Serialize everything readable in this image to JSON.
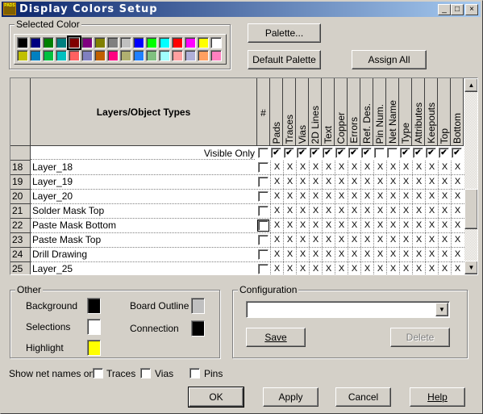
{
  "window": {
    "title": "Display Colors Setup",
    "icon_text": "PADS",
    "controls": [
      "_",
      "□",
      "×"
    ]
  },
  "selected_color": {
    "label": "Selected Color",
    "selected_index": 4,
    "row1": [
      "#000000",
      "#000080",
      "#008000",
      "#008080",
      "#800000",
      "#800080",
      "#808000",
      "#808080",
      "#c0c0c0",
      "#0000ff",
      "#00ff00",
      "#00ffff",
      "#ff0000",
      "#ff00ff",
      "#ffff00",
      "#ffffff"
    ],
    "row2": [
      "#c0c000",
      "#0080c0",
      "#00c040",
      "#00c0c0",
      "#ff6060",
      "#8080c0",
      "#c06000",
      "#ff0080",
      "#b0b070",
      "#2080ff",
      "#80c080",
      "#a0ffff",
      "#ffa0a0",
      "#b0b0d8",
      "#ffa060",
      "#ff80c0"
    ]
  },
  "buttons": {
    "palette": "Palette...",
    "default_palette": "Default Palette",
    "assign_all": "Assign All",
    "ok": "OK",
    "apply": "Apply",
    "cancel": "Cancel",
    "help": "Help"
  },
  "grid": {
    "header": "Layers/Object Types",
    "hash": "#",
    "columns": [
      "Pads",
      "Traces",
      "Vias",
      "2D Lines",
      "Text",
      "Copper",
      "Errors",
      "Ref. Des.",
      "Pin Num.",
      "Net Name",
      "Type",
      "Attributes",
      "Keepouts",
      "Top",
      "Bottom"
    ],
    "visible_only_label": "Visible Only",
    "visible_only_hash": false,
    "visible_only": [
      true,
      true,
      true,
      true,
      true,
      true,
      true,
      true,
      false,
      false,
      true,
      true,
      true,
      true,
      true
    ],
    "cell_mark": "X",
    "rows": [
      {
        "num": "18",
        "name": "Layer_18"
      },
      {
        "num": "19",
        "name": "Layer_19"
      },
      {
        "num": "20",
        "name": "Layer_20"
      },
      {
        "num": "21",
        "name": "Solder Mask Top"
      },
      {
        "num": "22",
        "name": "Paste Mask Bottom"
      },
      {
        "num": "23",
        "name": "Paste Mask Top"
      },
      {
        "num": "24",
        "name": "Drill Drawing"
      },
      {
        "num": "25",
        "name": "Layer_25"
      }
    ]
  },
  "other": {
    "label": "Other",
    "items": [
      {
        "label": "Background",
        "color": "#000000"
      },
      {
        "label": "Selections",
        "color": "#ffffff"
      },
      {
        "label": "Highlight",
        "color": "#ffff00"
      },
      {
        "label": "Board Outline",
        "color": "#c0c0c0"
      },
      {
        "label": "Connection",
        "color": "#000000"
      }
    ]
  },
  "configuration": {
    "label": "Configuration",
    "value": "",
    "save": "Save",
    "delete": "Delete"
  },
  "net_names": {
    "label": "Show net names on",
    "traces": "Traces",
    "vias": "Vias",
    "pins": "Pins",
    "traces_checked": false,
    "vias_checked": false,
    "pins_checked": false
  }
}
